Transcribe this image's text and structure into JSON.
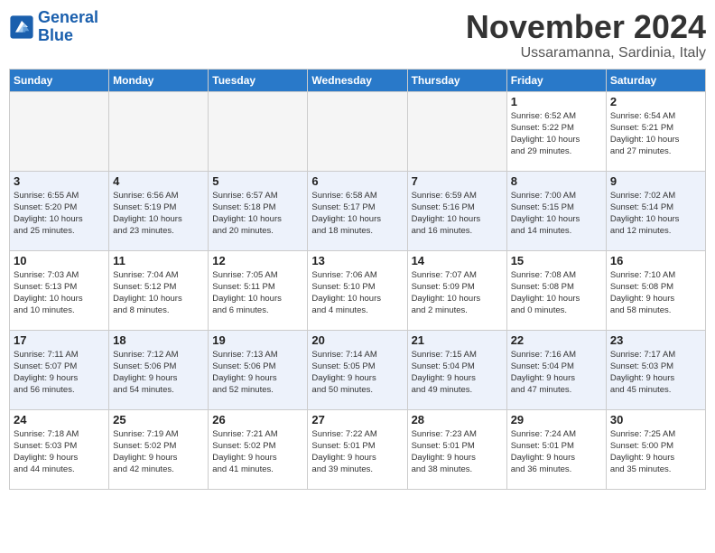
{
  "header": {
    "logo_line1": "General",
    "logo_line2": "Blue",
    "month": "November 2024",
    "location": "Ussaramanna, Sardinia, Italy"
  },
  "days_of_week": [
    "Sunday",
    "Monday",
    "Tuesday",
    "Wednesday",
    "Thursday",
    "Friday",
    "Saturday"
  ],
  "weeks": [
    [
      {
        "day": "",
        "info": "",
        "empty": true
      },
      {
        "day": "",
        "info": "",
        "empty": true
      },
      {
        "day": "",
        "info": "",
        "empty": true
      },
      {
        "day": "",
        "info": "",
        "empty": true
      },
      {
        "day": "",
        "info": "",
        "empty": true
      },
      {
        "day": "1",
        "info": "Sunrise: 6:52 AM\nSunset: 5:22 PM\nDaylight: 10 hours\nand 29 minutes."
      },
      {
        "day": "2",
        "info": "Sunrise: 6:54 AM\nSunset: 5:21 PM\nDaylight: 10 hours\nand 27 minutes."
      }
    ],
    [
      {
        "day": "3",
        "info": "Sunrise: 6:55 AM\nSunset: 5:20 PM\nDaylight: 10 hours\nand 25 minutes."
      },
      {
        "day": "4",
        "info": "Sunrise: 6:56 AM\nSunset: 5:19 PM\nDaylight: 10 hours\nand 23 minutes."
      },
      {
        "day": "5",
        "info": "Sunrise: 6:57 AM\nSunset: 5:18 PM\nDaylight: 10 hours\nand 20 minutes."
      },
      {
        "day": "6",
        "info": "Sunrise: 6:58 AM\nSunset: 5:17 PM\nDaylight: 10 hours\nand 18 minutes."
      },
      {
        "day": "7",
        "info": "Sunrise: 6:59 AM\nSunset: 5:16 PM\nDaylight: 10 hours\nand 16 minutes."
      },
      {
        "day": "8",
        "info": "Sunrise: 7:00 AM\nSunset: 5:15 PM\nDaylight: 10 hours\nand 14 minutes."
      },
      {
        "day": "9",
        "info": "Sunrise: 7:02 AM\nSunset: 5:14 PM\nDaylight: 10 hours\nand 12 minutes."
      }
    ],
    [
      {
        "day": "10",
        "info": "Sunrise: 7:03 AM\nSunset: 5:13 PM\nDaylight: 10 hours\nand 10 minutes."
      },
      {
        "day": "11",
        "info": "Sunrise: 7:04 AM\nSunset: 5:12 PM\nDaylight: 10 hours\nand 8 minutes."
      },
      {
        "day": "12",
        "info": "Sunrise: 7:05 AM\nSunset: 5:11 PM\nDaylight: 10 hours\nand 6 minutes."
      },
      {
        "day": "13",
        "info": "Sunrise: 7:06 AM\nSunset: 5:10 PM\nDaylight: 10 hours\nand 4 minutes."
      },
      {
        "day": "14",
        "info": "Sunrise: 7:07 AM\nSunset: 5:09 PM\nDaylight: 10 hours\nand 2 minutes."
      },
      {
        "day": "15",
        "info": "Sunrise: 7:08 AM\nSunset: 5:08 PM\nDaylight: 10 hours\nand 0 minutes."
      },
      {
        "day": "16",
        "info": "Sunrise: 7:10 AM\nSunset: 5:08 PM\nDaylight: 9 hours\nand 58 minutes."
      }
    ],
    [
      {
        "day": "17",
        "info": "Sunrise: 7:11 AM\nSunset: 5:07 PM\nDaylight: 9 hours\nand 56 minutes."
      },
      {
        "day": "18",
        "info": "Sunrise: 7:12 AM\nSunset: 5:06 PM\nDaylight: 9 hours\nand 54 minutes."
      },
      {
        "day": "19",
        "info": "Sunrise: 7:13 AM\nSunset: 5:06 PM\nDaylight: 9 hours\nand 52 minutes."
      },
      {
        "day": "20",
        "info": "Sunrise: 7:14 AM\nSunset: 5:05 PM\nDaylight: 9 hours\nand 50 minutes."
      },
      {
        "day": "21",
        "info": "Sunrise: 7:15 AM\nSunset: 5:04 PM\nDaylight: 9 hours\nand 49 minutes."
      },
      {
        "day": "22",
        "info": "Sunrise: 7:16 AM\nSunset: 5:04 PM\nDaylight: 9 hours\nand 47 minutes."
      },
      {
        "day": "23",
        "info": "Sunrise: 7:17 AM\nSunset: 5:03 PM\nDaylight: 9 hours\nand 45 minutes."
      }
    ],
    [
      {
        "day": "24",
        "info": "Sunrise: 7:18 AM\nSunset: 5:03 PM\nDaylight: 9 hours\nand 44 minutes."
      },
      {
        "day": "25",
        "info": "Sunrise: 7:19 AM\nSunset: 5:02 PM\nDaylight: 9 hours\nand 42 minutes."
      },
      {
        "day": "26",
        "info": "Sunrise: 7:21 AM\nSunset: 5:02 PM\nDaylight: 9 hours\nand 41 minutes."
      },
      {
        "day": "27",
        "info": "Sunrise: 7:22 AM\nSunset: 5:01 PM\nDaylight: 9 hours\nand 39 minutes."
      },
      {
        "day": "28",
        "info": "Sunrise: 7:23 AM\nSunset: 5:01 PM\nDaylight: 9 hours\nand 38 minutes."
      },
      {
        "day": "29",
        "info": "Sunrise: 7:24 AM\nSunset: 5:01 PM\nDaylight: 9 hours\nand 36 minutes."
      },
      {
        "day": "30",
        "info": "Sunrise: 7:25 AM\nSunset: 5:00 PM\nDaylight: 9 hours\nand 35 minutes."
      }
    ]
  ]
}
